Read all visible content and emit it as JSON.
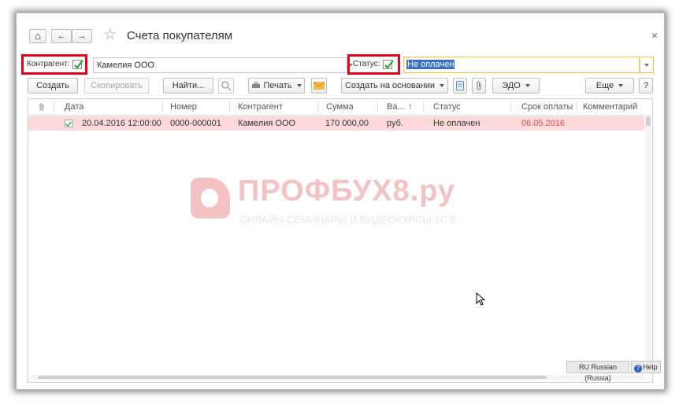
{
  "window": {
    "title": "Счета покупателям",
    "close_glyph": "×"
  },
  "nav": {
    "home": "⌂",
    "back": "←",
    "forward": "→",
    "star": "☆"
  },
  "filter": {
    "contractor_label": "Контрагент:",
    "contractor_value": "Камелия ООО",
    "status_label": "Статус:",
    "status_value": "Не оплачен"
  },
  "toolbar": {
    "create": "Создать",
    "copy": "Скопировать",
    "find": "Найти...",
    "print": "Печать",
    "create_based_on": "Создать на основании",
    "edo": "ЭДО",
    "more": "Еще",
    "help": "?"
  },
  "table": {
    "columns": [
      "Дата",
      "Номер",
      "Контрагент",
      "Сумма",
      "Ва...",
      "Статус",
      "Срок оплаты",
      "Комментарий"
    ],
    "sort_indicator": "↑",
    "rows": [
      {
        "date": "20.04.2016 12:00:00",
        "number": "0000-000001",
        "contractor": "Камелия ООО",
        "sum": "170 000,00",
        "currency": "руб.",
        "status": "Не оплачен",
        "due": "06.05.2016",
        "comment": ""
      }
    ]
  },
  "watermark": {
    "brand": "ПРОФБУХ8.ру",
    "tagline": "ОНЛАЙН-СЕМИНАРЫ И ВИДЕОКУРСЫ 1С:8"
  },
  "statusbar": {
    "lang": "RU Russian (Russia)",
    "help": "Help"
  },
  "colors": {
    "row_highlight": "#fbd9d9",
    "due_red": "#d9534f",
    "accent_red": "#e3001b",
    "watermark": "#f3c3c3"
  }
}
